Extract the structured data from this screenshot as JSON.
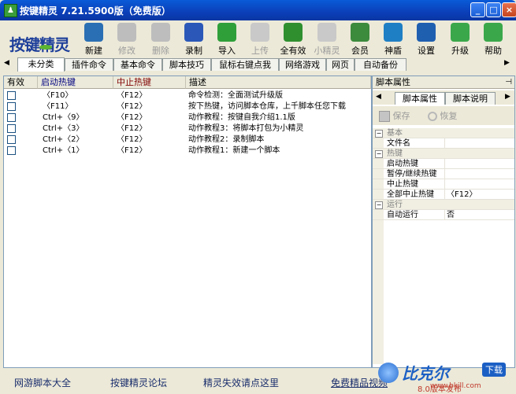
{
  "window": {
    "title": "按键精灵 7.21.5900版（免费版）",
    "app_icon_glyph": "♟",
    "controls": [
      "_",
      "□",
      "×"
    ]
  },
  "toolbar": {
    "logo": "按键精灵",
    "buttons": [
      {
        "label": "新建",
        "icon": "new-script-icon",
        "enabled": true,
        "color": "#2a6fb3"
      },
      {
        "label": "修改",
        "icon": "edit-icon",
        "enabled": false,
        "color": "#bdbdbd"
      },
      {
        "label": "删除",
        "icon": "trash-icon",
        "enabled": false,
        "color": "#bdbdbd"
      },
      {
        "label": "录制",
        "icon": "record-icon",
        "enabled": true,
        "color": "#2b58b8"
      },
      {
        "label": "导入",
        "icon": "import-icon",
        "enabled": true,
        "color": "#2f9f3a"
      },
      {
        "label": "上传",
        "icon": "upload-icon",
        "enabled": false,
        "color": "#c9c9c9"
      },
      {
        "label": "全有效",
        "icon": "check-all-icon",
        "enabled": true,
        "color": "#2f8f2f"
      },
      {
        "label": "小精灵",
        "icon": "mini-sprite-icon",
        "enabled": false,
        "color": "#c9c9c9"
      },
      {
        "label": "会员",
        "icon": "member-icon",
        "enabled": true,
        "color": "#3c8a3c"
      },
      {
        "label": "神盾",
        "icon": "shield-icon",
        "enabled": true,
        "color": "#1f7fc4"
      },
      {
        "label": "设置",
        "icon": "gear-icon",
        "enabled": true,
        "color": "#1f5fb0"
      },
      {
        "label": "升级",
        "icon": "upgrade-icon",
        "enabled": true,
        "color": "#3aa84a"
      },
      {
        "label": "帮助",
        "icon": "help-icon",
        "enabled": true,
        "color": "#3aa84a"
      }
    ]
  },
  "tabs": {
    "left_arrow": "◀",
    "right_arrow": "▶",
    "items": [
      "未分类",
      "插件命令",
      "基本命令",
      "脚本技巧",
      "鼠标右键点我",
      "网络游戏",
      "网页",
      "自动备份"
    ],
    "active_index": 0
  },
  "script_list": {
    "columns": [
      "有效",
      "启动热键",
      "中止热键",
      "描述"
    ],
    "header_colors": {
      "start": "#000080",
      "stop": "#800000"
    },
    "rows": [
      {
        "enabled": false,
        "start": "〈F10〉",
        "stop": "〈F12〉",
        "desc": "命令检测：全面测试升级版"
      },
      {
        "enabled": false,
        "start": "〈F11〉",
        "stop": "〈F12〉",
        "desc": "按下热键，访问脚本仓库，上千脚本任您下载"
      },
      {
        "enabled": false,
        "start": "Ctrl+〈9〉",
        "stop": "〈F12〉",
        "desc": "动作教程：按键自我介绍1.1版"
      },
      {
        "enabled": false,
        "start": "Ctrl+〈3〉",
        "stop": "〈F12〉",
        "desc": "动作教程3：将脚本打包为小精灵"
      },
      {
        "enabled": false,
        "start": "Ctrl+〈2〉",
        "stop": "〈F12〉",
        "desc": "动作教程2：录制脚本"
      },
      {
        "enabled": false,
        "start": "Ctrl+〈1〉",
        "stop": "〈F12〉",
        "desc": "动作教程1：新建一个脚本"
      }
    ]
  },
  "properties": {
    "title": "脚本属性",
    "pin": "⊣",
    "tabs": [
      "脚本属性",
      "脚本说明"
    ],
    "tab_arrows": [
      "◀",
      "▶"
    ],
    "save_label": "保存",
    "restore_label": "恢复",
    "categories": [
      {
        "name": "基本",
        "toggle": "⊟",
        "rows": [
          {
            "key": "文件名",
            "value": ""
          }
        ]
      },
      {
        "name": "热键",
        "toggle": "⊟",
        "rows": [
          {
            "key": "启动热键",
            "value": ""
          },
          {
            "key": "暂停/继续热键",
            "value": ""
          },
          {
            "key": "中止热键",
            "value": ""
          },
          {
            "key": "全部中止热键",
            "value": "〈F12〉"
          }
        ]
      },
      {
        "name": "运行",
        "toggle": "⊟",
        "rows": [
          {
            "key": "自动运行",
            "value": "否"
          }
        ]
      }
    ]
  },
  "footer": {
    "links": [
      "网游脚本大全",
      "按键精灵论坛",
      "精灵失效请点这里",
      "免费精品视频"
    ],
    "version_fragment": "8.0版本发布",
    "watermark": {
      "text": "比克尔",
      "badge": "下载",
      "url": "www.bkill.com"
    }
  },
  "colors": {
    "title_bar": "#0b3fb9",
    "accent": "#316ac5"
  }
}
